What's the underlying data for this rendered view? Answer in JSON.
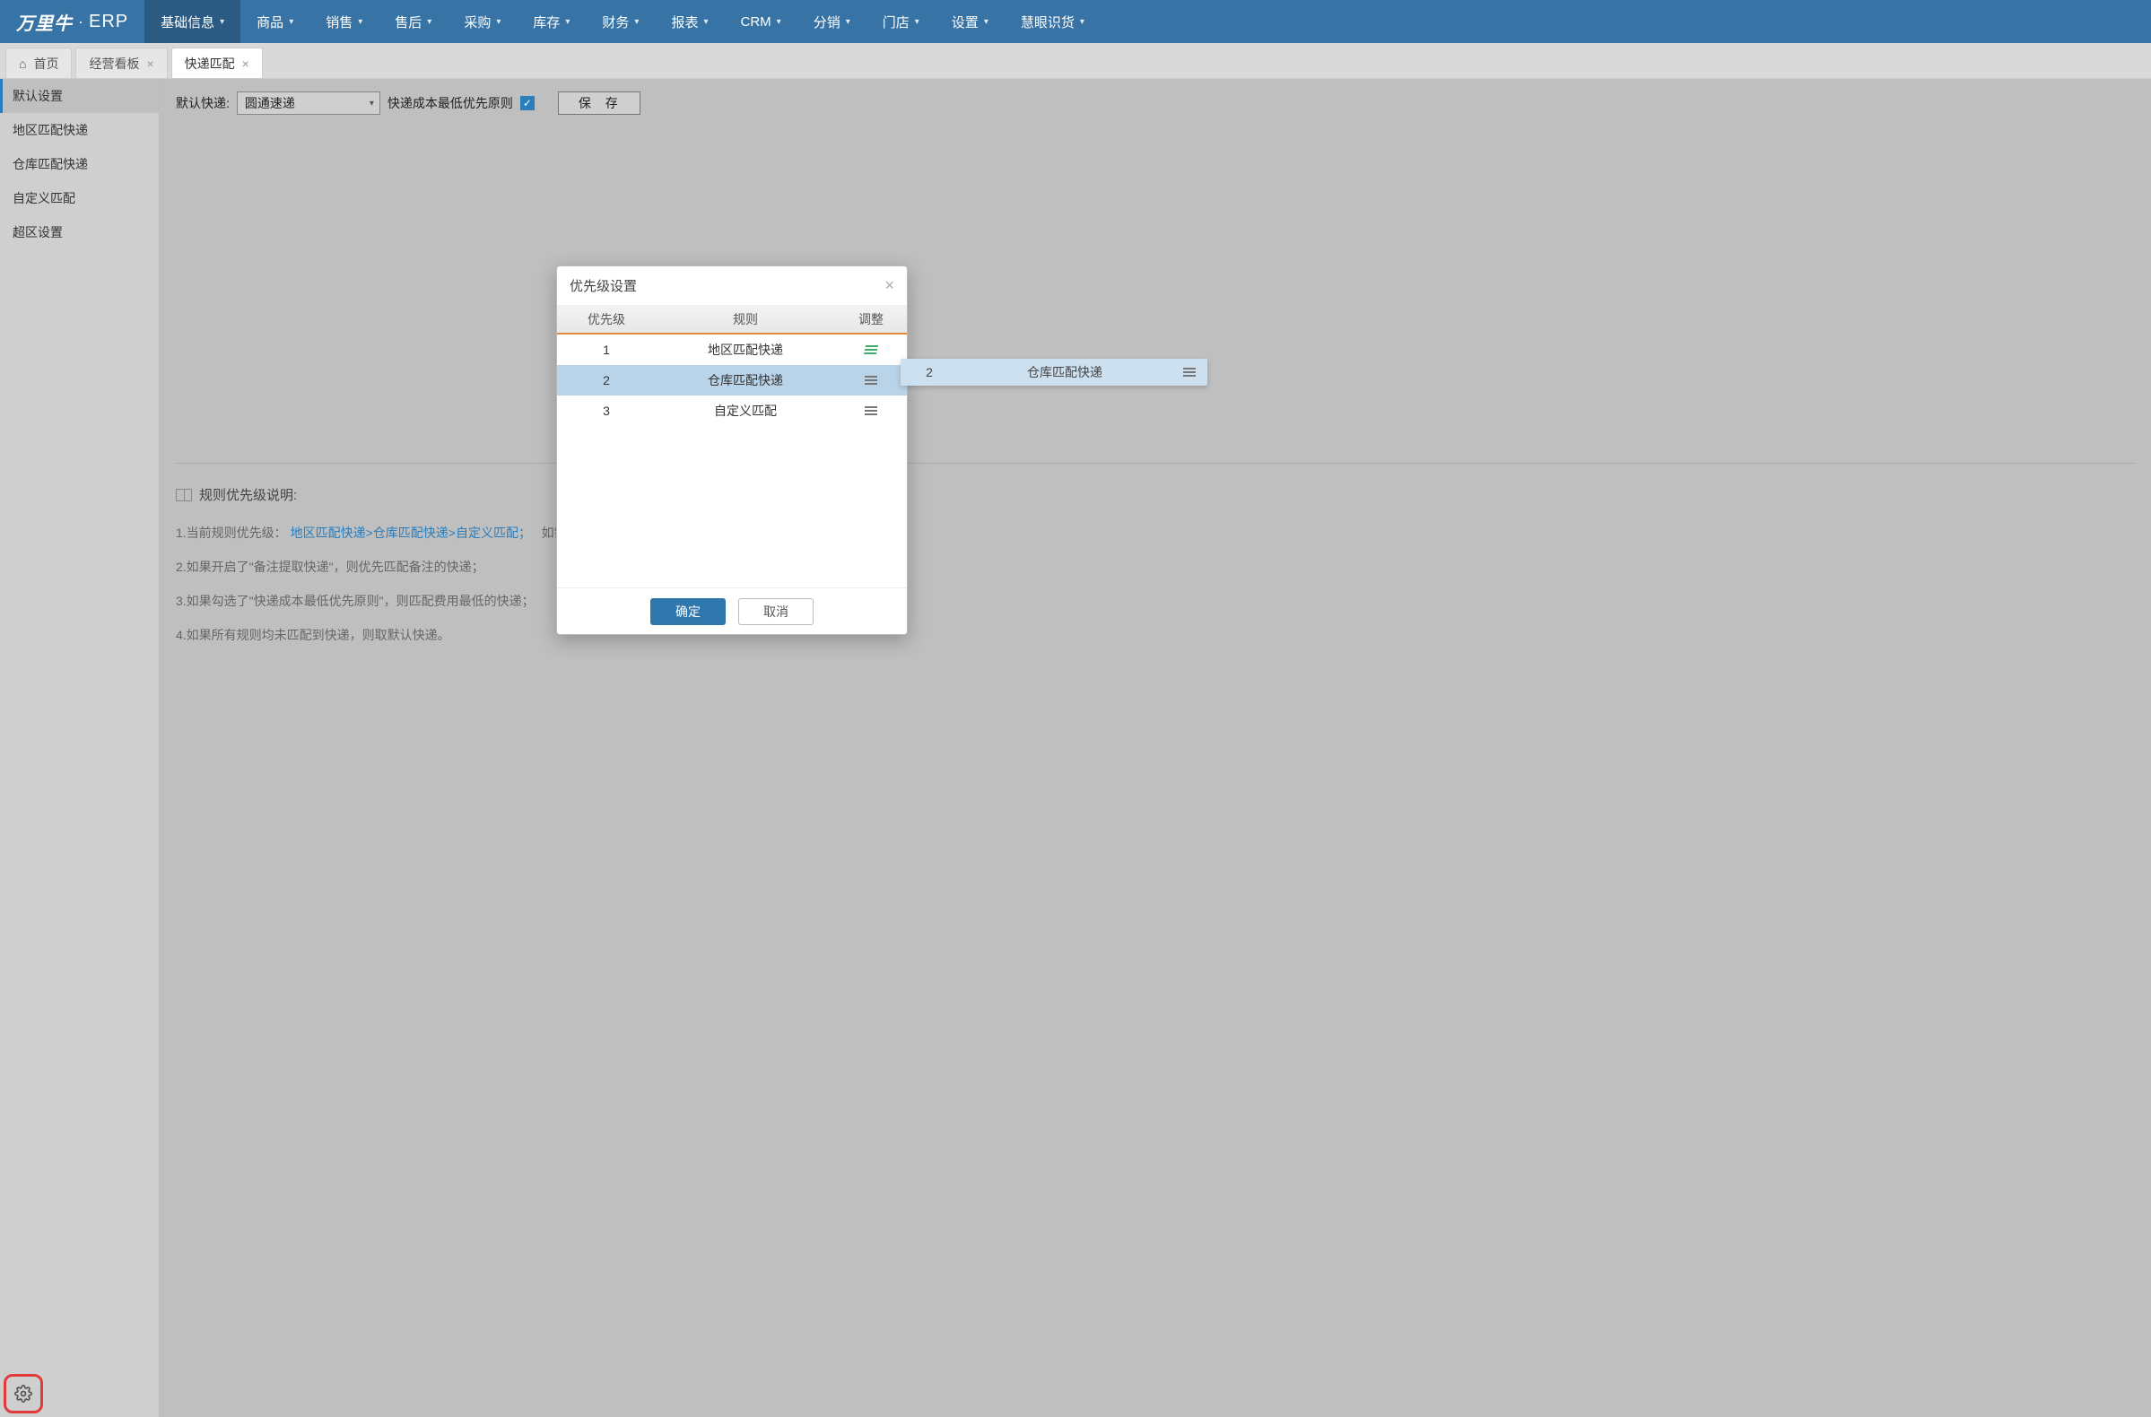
{
  "brand": {
    "logo": "万里牛",
    "sep": "·",
    "erp": "ERP"
  },
  "nav": [
    {
      "label": "基础信息",
      "active": true
    },
    {
      "label": "商品"
    },
    {
      "label": "销售"
    },
    {
      "label": "售后"
    },
    {
      "label": "采购"
    },
    {
      "label": "库存"
    },
    {
      "label": "财务"
    },
    {
      "label": "报表"
    },
    {
      "label": "CRM"
    },
    {
      "label": "分销"
    },
    {
      "label": "门店"
    },
    {
      "label": "设置"
    },
    {
      "label": "慧眼识货"
    }
  ],
  "tabs": [
    {
      "label": "首页",
      "home": true
    },
    {
      "label": "经营看板"
    },
    {
      "label": "快递匹配",
      "active": true
    }
  ],
  "sidebar": [
    {
      "label": "默认设置",
      "active": true
    },
    {
      "label": "地区匹配快递"
    },
    {
      "label": "仓库匹配快递"
    },
    {
      "label": "自定义匹配"
    },
    {
      "label": "超区设置"
    }
  ],
  "form": {
    "default_express_label": "默认快递:",
    "default_express_value": "圆通速递",
    "cost_first_label": "快递成本最低优先原则",
    "save_label": "保 存"
  },
  "rules": {
    "title": "规则优先级说明:",
    "line1_prefix": "1.当前规则优先级：",
    "line1_links": [
      "地区匹配快递",
      "仓库匹配快递",
      "自定义匹配"
    ],
    "line1_suffix": "；",
    "line1_tail": "如需",
    "line2": "2.如果开启了\"备注提取快递\"，则优先匹配备注的快递；",
    "line3": "3.如果勾选了\"快递成本最低优先原则\"，则匹配费用最低的快递；",
    "line4": "4.如果所有规则均未匹配到快递，则取默认快递。"
  },
  "modal": {
    "title": "优先级设置",
    "col_prio": "优先级",
    "col_rule": "规则",
    "col_adj": "调整",
    "rows": [
      {
        "prio": "1",
        "rule": "地区匹配快递",
        "green": true
      },
      {
        "prio": "2",
        "rule": "仓库匹配快递",
        "selected": true
      },
      {
        "prio": "3",
        "rule": "自定义匹配"
      }
    ],
    "ok": "确定",
    "cancel": "取消"
  },
  "ghost": {
    "prio": "2",
    "rule": "仓库匹配快递"
  }
}
